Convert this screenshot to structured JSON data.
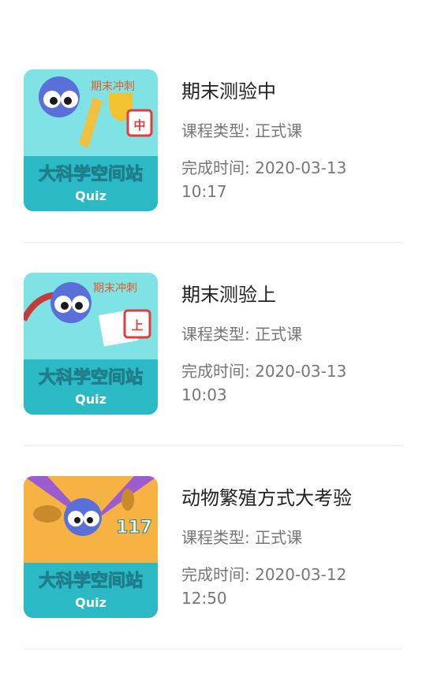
{
  "courses": [
    {
      "title": "期末测验中",
      "type_text": "课程类型: 正式课",
      "time_text": "完成时间: 2020-03-13 10:17",
      "thumb": {
        "brand_text": "大科学空间站",
        "quiz_text": "Quiz",
        "banner_text": "期末冲刺",
        "badge_text": "中",
        "bg_color": "#7fe3e6",
        "accent_color": "#2bb9c6"
      }
    },
    {
      "title": "期末测验上",
      "type_text": "课程类型: 正式课",
      "time_text": "完成时间: 2020-03-13 10:03",
      "thumb": {
        "brand_text": "大科学空间站",
        "quiz_text": "Quiz",
        "banner_text": "期末冲刺",
        "badge_text": "上",
        "bg_color": "#7fe3e6",
        "accent_color": "#2bb9c6"
      }
    },
    {
      "title": "动物繁殖方式大考验",
      "type_text": "课程类型: 正式课",
      "time_text": "完成时间: 2020-03-12 12:50",
      "thumb": {
        "brand_text": "大科学空间站",
        "quiz_text": "Quiz",
        "banner_text": "",
        "badge_text": "117",
        "bg_color": "#f6b343",
        "accent_color": "#2bb9c6"
      }
    }
  ]
}
